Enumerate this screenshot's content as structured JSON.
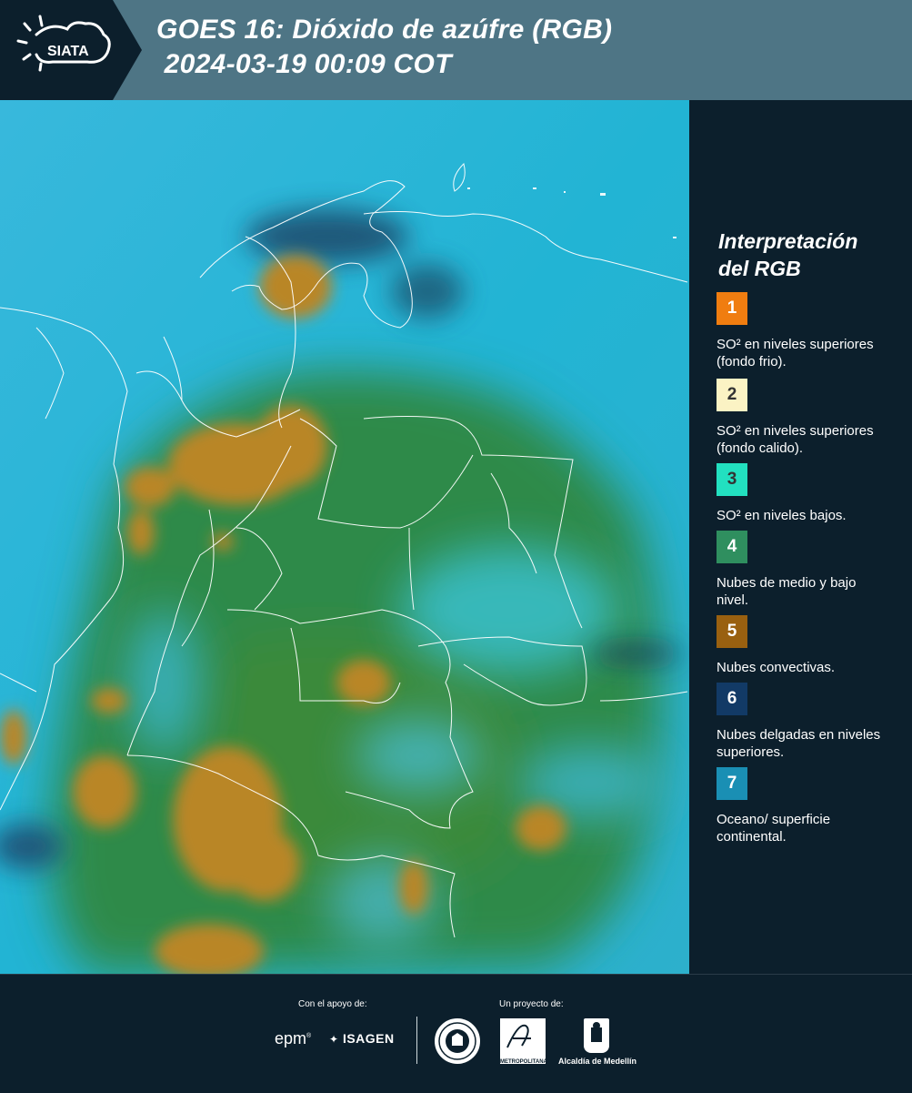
{
  "header": {
    "logo_text": "SIATA",
    "title_line1": "GOES 16: Dióxido de azúfre (RGB)",
    "title_line2": " 2024-03-19 00:09 COT"
  },
  "legend": {
    "title_line1": "Interpretación",
    "title_line2": "del RGB",
    "items": [
      {
        "number": "1",
        "color": "#f07d10",
        "text": "SO² en niveles superiores (fondo frio)."
      },
      {
        "number": "2",
        "color": "#fbf3c4",
        "text": "SO² en niveles superiores (fondo calido)."
      },
      {
        "number": "3",
        "color": "#22e0c0",
        "text": "SO² en niveles bajos."
      },
      {
        "number": "4",
        "color": "#2f8f5f",
        "text": "Nubes de medio y bajo nivel."
      },
      {
        "number": "5",
        "color": "#996010",
        "text": "Nubes convectivas."
      },
      {
        "number": "6",
        "color": "#123a66",
        "text": "Nubes delgadas en niveles superiores."
      },
      {
        "number": "7",
        "color": "#1a8fb4",
        "text": "Oceano/ superficie continental."
      }
    ]
  },
  "footer": {
    "support_label": "Con el apoyo de:",
    "project_label": "Un proyecto de:",
    "epm": "epm",
    "isagen": "ISAGEN",
    "area_caption": "METROPOLITANA",
    "alcaldia": "Alcaldía de Medellín"
  }
}
